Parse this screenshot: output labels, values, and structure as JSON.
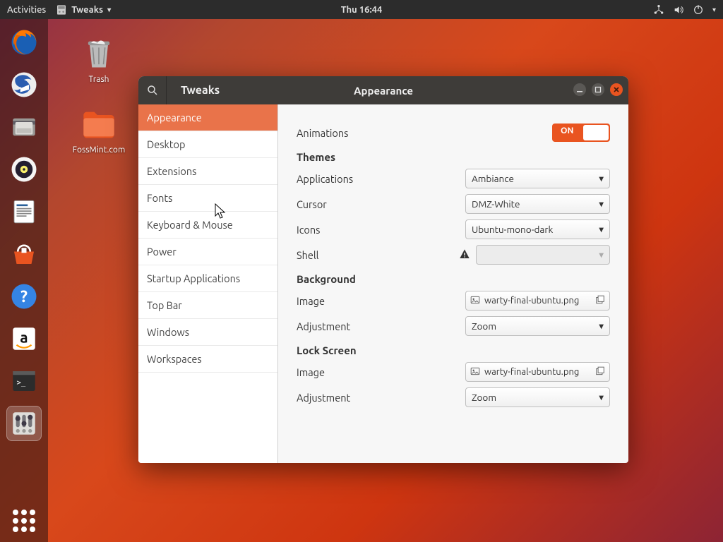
{
  "topbar": {
    "activities": "Activities",
    "app_name": "Tweaks",
    "clock": "Thu 16:44"
  },
  "desktop": {
    "trash": "Trash",
    "folder": "FossMint.com"
  },
  "window": {
    "title": "Tweaks",
    "page_title": "Appearance",
    "sidebar": [
      "Appearance",
      "Desktop",
      "Extensions",
      "Fonts",
      "Keyboard & Mouse",
      "Power",
      "Startup Applications",
      "Top Bar",
      "Windows",
      "Workspaces"
    ],
    "animations_label": "Animations",
    "switch_on": "ON",
    "themes_header": "Themes",
    "theme_rows": {
      "applications": {
        "label": "Applications",
        "value": "Ambiance"
      },
      "cursor": {
        "label": "Cursor",
        "value": "DMZ-White"
      },
      "icons": {
        "label": "Icons",
        "value": "Ubuntu-mono-dark"
      },
      "shell": {
        "label": "Shell",
        "value": ""
      }
    },
    "background_header": "Background",
    "image_label": "Image",
    "adjustment_label": "Adjustment",
    "bg_image": "warty-final-ubuntu.png",
    "bg_adjustment": "Zoom",
    "lockscreen_header": "Lock Screen",
    "ls_image": "warty-final-ubuntu.png",
    "ls_adjustment": "Zoom"
  }
}
